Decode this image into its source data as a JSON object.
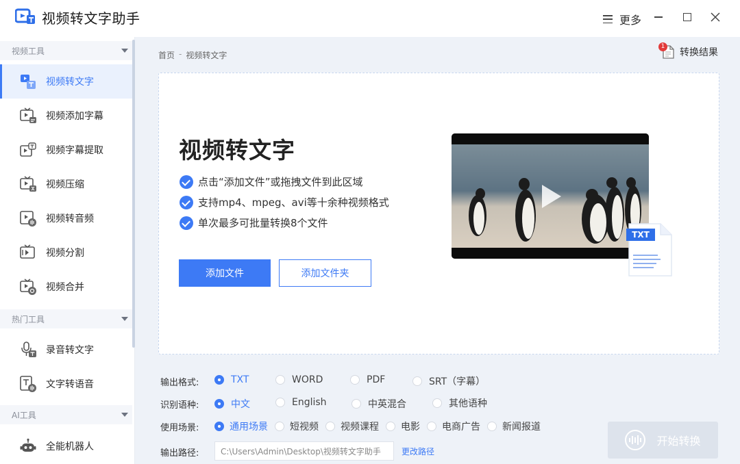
{
  "app": {
    "title": "视频转文字助手",
    "more_label": "更多"
  },
  "sidebar": {
    "sections": [
      {
        "label": "视频工具"
      },
      {
        "label": "热门工具"
      },
      {
        "label": "AI工具"
      }
    ],
    "items": [
      {
        "label": "视频转文字",
        "icon": "video-to-text-icon",
        "active": true
      },
      {
        "label": "视频添加字幕",
        "icon": "video-add-subtitle-icon"
      },
      {
        "label": "视频字幕提取",
        "icon": "subtitle-extract-icon"
      },
      {
        "label": "视频压缩",
        "icon": "video-compress-icon"
      },
      {
        "label": "视频转音频",
        "icon": "video-to-audio-icon"
      },
      {
        "label": "视频分割",
        "icon": "video-split-icon"
      },
      {
        "label": "视频合并",
        "icon": "video-merge-icon"
      },
      {
        "label": "录音转文字",
        "icon": "recording-to-text-icon"
      },
      {
        "label": "文字转语音",
        "icon": "text-to-speech-icon"
      },
      {
        "label": "全能机器人",
        "icon": "robot-icon"
      }
    ]
  },
  "breadcrumb": {
    "home": "首页",
    "sep": "-",
    "current": "视频转文字"
  },
  "results": {
    "label": "转换结果",
    "badge": "1"
  },
  "hero": {
    "title": "视频转文字",
    "features": [
      "点击“添加文件”或拖拽文件到此区域",
      "支持mp4、mpeg、avi等十余种视频格式",
      "单次最多可批量转换8个文件"
    ],
    "add_file": "添加文件",
    "add_folder": "添加文件夹",
    "doc_tag": "TXT"
  },
  "options": {
    "format": {
      "label": "输出格式:",
      "choices": [
        "TXT",
        "WORD",
        "PDF",
        "SRT（字幕）"
      ],
      "selected": "TXT"
    },
    "language": {
      "label": "识别语种:",
      "choices": [
        "中文",
        "English",
        "中英混合",
        "其他语种"
      ],
      "selected": "中文"
    },
    "scene": {
      "label": "使用场景:",
      "choices": [
        "通用场景",
        "短视频",
        "视频课程",
        "电影",
        "电商广告",
        "新闻报道"
      ],
      "selected": "通用场景"
    },
    "path": {
      "label": "输出路径:",
      "value": "C:\\Users\\Admin\\Desktop\\视频转文字助手",
      "change": "更改路径"
    }
  },
  "start_button": "开始转换",
  "colors": {
    "accent": "#3d7af5",
    "badge": "#e23b3b",
    "disabled": "#dde3ec"
  }
}
